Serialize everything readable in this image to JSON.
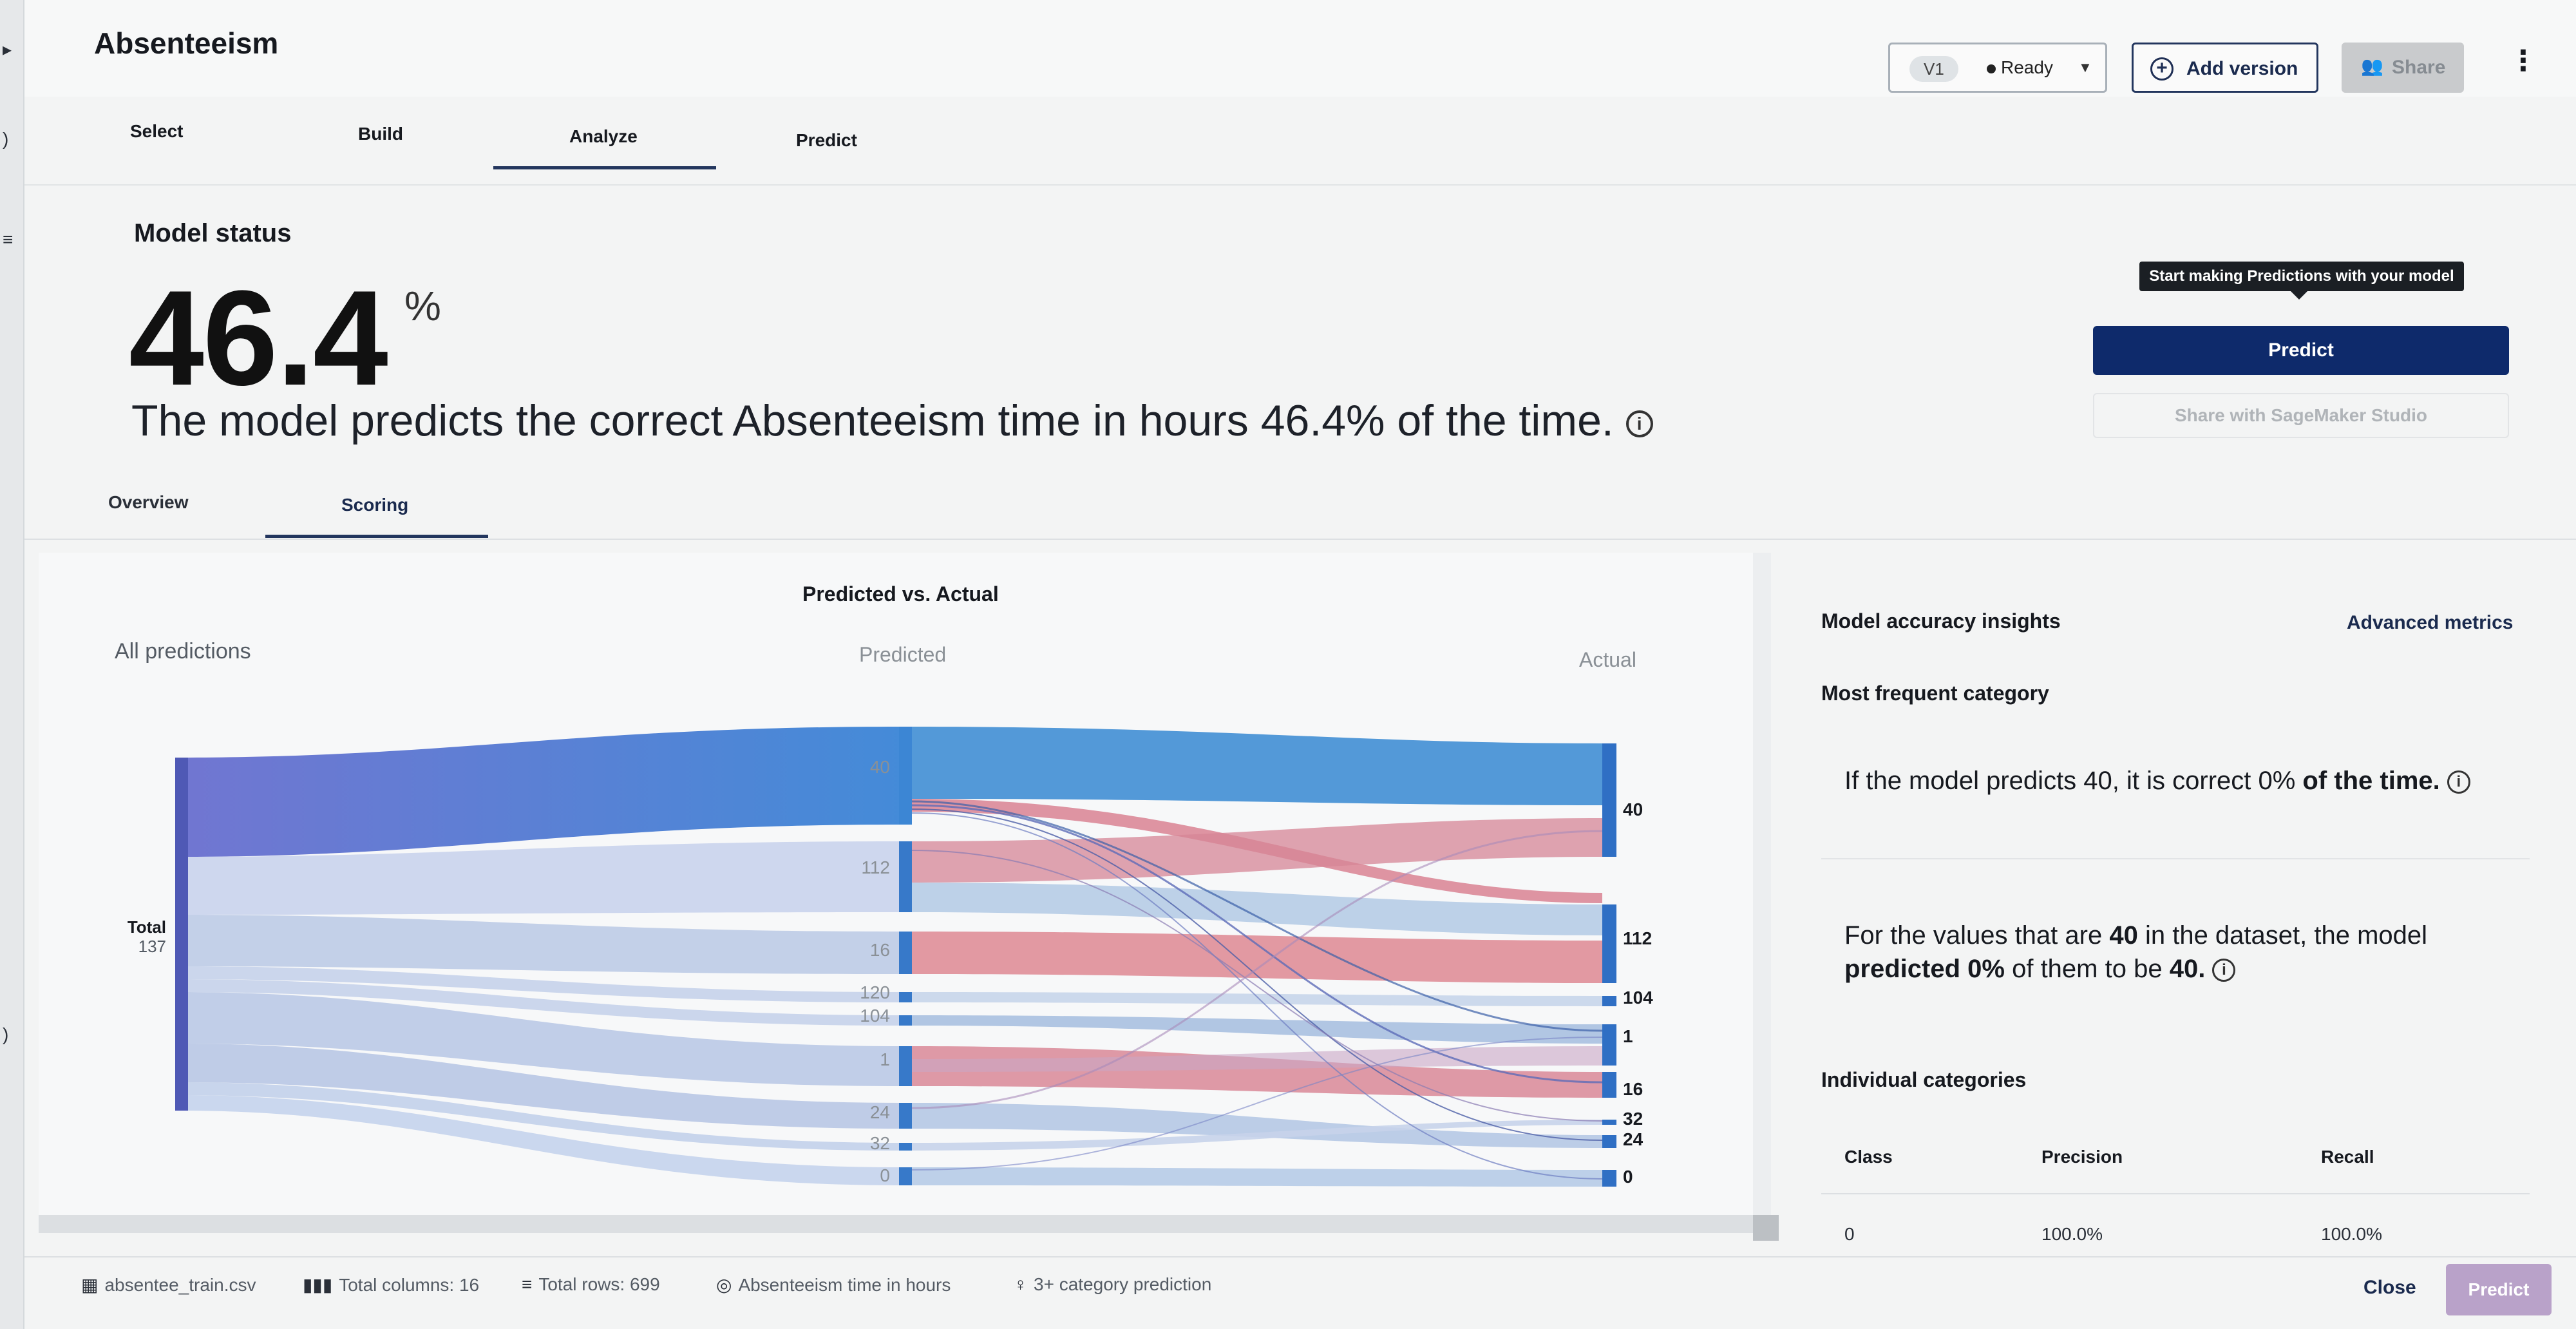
{
  "app": {
    "title": "Absenteeism",
    "version": {
      "tag": "V1",
      "status": "Ready"
    },
    "add_version_label": "Add version",
    "share_label": "Share",
    "more_label": "⋮"
  },
  "tabs": [
    {
      "label": "Select"
    },
    {
      "label": "Build"
    },
    {
      "label": "Analyze"
    },
    {
      "label": "Predict"
    }
  ],
  "status": {
    "heading": "Model status",
    "accuracy": "46.4",
    "accuracy_unit": "%",
    "description": "The model predicts the correct Absenteeism time in hours 46.4% of the time."
  },
  "actions": {
    "tooltip": "Start making Predictions with your model",
    "predict_label": "Predict",
    "share_studio_label": "Share with SageMaker Studio"
  },
  "sub_tabs": [
    {
      "label": "Overview"
    },
    {
      "label": "Scoring"
    }
  ],
  "chart_data": {
    "type": "sankey",
    "title": "Predicted vs. Actual",
    "columns": [
      "All predictions",
      "Predicted",
      "Actual"
    ],
    "total": {
      "label": "Total",
      "value": "137"
    },
    "predicted_nodes": [
      "40",
      "112",
      "16",
      "120",
      "104",
      "1",
      "24",
      "32",
      "0"
    ],
    "actual_nodes": [
      "40",
      "112",
      "104",
      "1",
      "16",
      "32",
      "24",
      "0"
    ],
    "colors": {
      "predicted_flow": "#3d7fd1",
      "actual_flow": "#d9707e",
      "light_flow": "#b8cde6",
      "node": "#2f6fc4"
    }
  },
  "insights": {
    "title": "Model accuracy insights",
    "advanced_metrics": "Advanced metrics",
    "most_frequent": "Most frequent category",
    "line1_a": "If the model predicts 40, it is correct 0%",
    "line1_b": "of the time.",
    "line2_a": "For the values that are",
    "line2_b": "40",
    "line2_c": "in the dataset, the model",
    "line2_d": "predicted 0%",
    "line2_e": "of them to be",
    "line2_f": "40.",
    "individual": "Individual categories",
    "table": {
      "headers": [
        "Class",
        "Precision",
        "Recall"
      ],
      "rows": [
        [
          "0",
          "100.0%",
          "100.0%"
        ]
      ]
    }
  },
  "footer": {
    "dataset": "absentee_train.csv",
    "columns": "Total columns: 16",
    "rows": "Total rows: 699",
    "target": "Absenteeism time in hours",
    "model_type": "3+ category prediction",
    "close": "Close",
    "predict": "Predict"
  }
}
